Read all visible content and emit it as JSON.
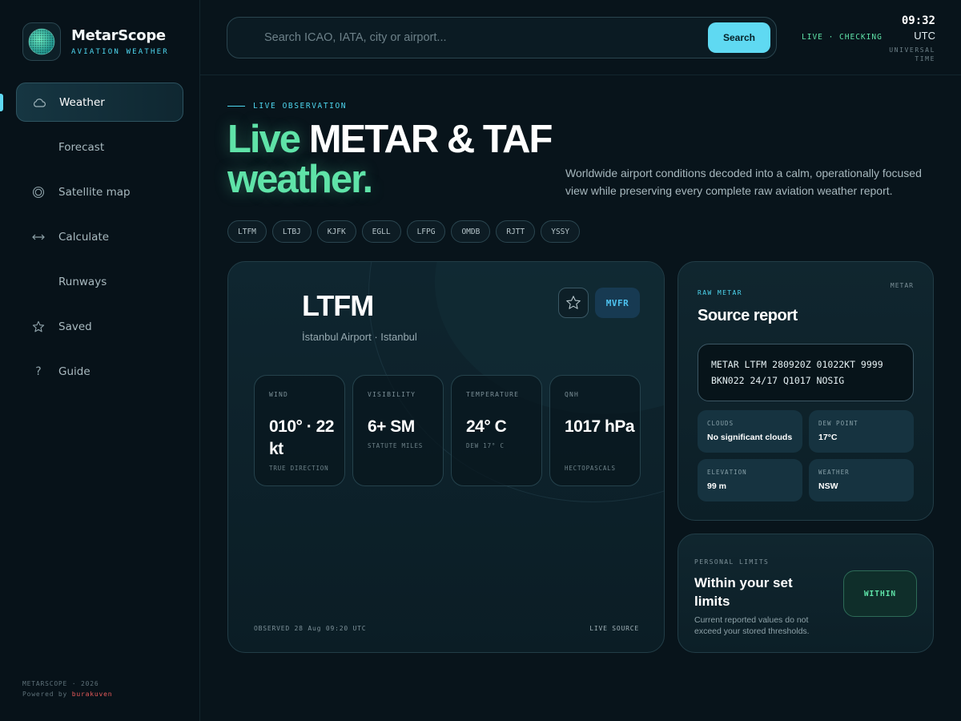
{
  "brand": {
    "name": "MetarScope",
    "subtitle": "AVIATION WEATHER"
  },
  "nav": {
    "items": [
      {
        "label": "Weather",
        "icon": "cloud-icon",
        "active": true
      },
      {
        "label": "Forecast",
        "icon": "none"
      },
      {
        "label": "Satellite map",
        "icon": "target-icon"
      },
      {
        "label": "Calculate",
        "icon": "arrows-horizontal-icon"
      },
      {
        "label": "Runways",
        "icon": "none"
      },
      {
        "label": "Saved",
        "icon": "star-icon"
      },
      {
        "label": "Guide",
        "icon": "question-icon"
      }
    ]
  },
  "sidebar_footer": {
    "line1": "METARSCOPE · 2026",
    "powered_prefix": "Powered by",
    "author": "burakuven"
  },
  "search": {
    "placeholder": "Search ICAO, IATA, city or airport...",
    "value": "",
    "button_label": "Search"
  },
  "status": {
    "live": "LIVE · CHECKING"
  },
  "clock": {
    "time": "09:32",
    "zone": "UTC",
    "label_line1": "UNIVERSAL",
    "label_line2": "TIME"
  },
  "hero": {
    "eyebrow": "LIVE OBSERVATION",
    "title_accent_1": "Live",
    "title_main": "METAR & TAF",
    "title_accent_2": "weather.",
    "description": "Worldwide airport conditions decoded into a calm, operationally focused view while preserving every complete raw aviation weather report."
  },
  "chips": [
    "LTFM",
    "LTBJ",
    "KJFK",
    "EGLL",
    "LFPG",
    "OMDB",
    "RJTT",
    "YSSY"
  ],
  "station": {
    "code": "LTFM",
    "name": "İstanbul Airport · Istanbul",
    "flight_category": "MVFR",
    "metrics": {
      "wind": {
        "label": "WIND",
        "value": "010° · 22 kt",
        "sub": "TRUE DIRECTION"
      },
      "visibility": {
        "label": "VISIBILITY",
        "value": "6+ SM",
        "sub": "STATUTE MILES"
      },
      "temperature": {
        "label": "TEMPERATURE",
        "value": "24° C",
        "sub": "DEW 17° C"
      },
      "qnh": {
        "label": "QNH",
        "value": "1017 hPa",
        "sub": "HECTOPASCALS"
      }
    },
    "observed": "OBSERVED 28 Aug 09:20 UTC",
    "source": "LIVE SOURCE"
  },
  "raw": {
    "eyebrow": "RAW METAR",
    "tag": "METAR",
    "title": "Source report",
    "line1": "METAR LTFM 280920Z 01022KT 9999",
    "line2": "BKN022 24/17 Q1017 NOSIG",
    "tiles": {
      "clouds": {
        "label": "CLOUDS",
        "value": "No significant clouds"
      },
      "dew_point": {
        "label": "DEW POINT",
        "value": "17°C"
      },
      "elevation": {
        "label": "ELEVATION",
        "value": "99 m"
      },
      "weather": {
        "label": "WEATHER",
        "value": "NSW"
      }
    }
  },
  "limits": {
    "eyebrow": "PERSONAL LIMITS",
    "title": "Within your set limits",
    "description": "Current reported values do not exceed your stored thresholds.",
    "badge": "WITHIN"
  },
  "colors": {
    "accent_cyan": "#5fd9f2",
    "accent_green": "#5fe3a8",
    "background": "#08141b",
    "mvfr_blue": "#4ec3f0"
  }
}
